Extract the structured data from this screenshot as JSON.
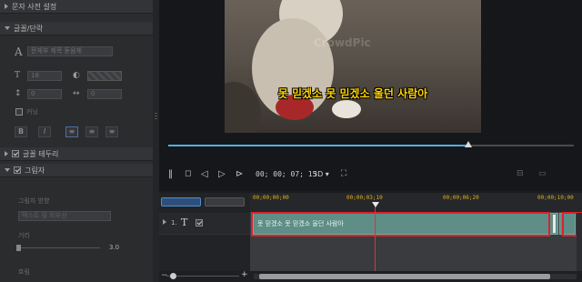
{
  "left_panel": {
    "section_char_preset": "문자 사전 설정",
    "section_font_paragraph": "글꼴/단락",
    "font_family_value": "문제부 제목 돋움체",
    "font_size_value": "18",
    "spacing_value": "0",
    "scale_value": "0",
    "extra_option_label": "커닝",
    "bold_label": "B",
    "italic_label": "I",
    "section_text_border": "글꼴 테두리",
    "section_shadow": "그림자",
    "shadow_type_label": "그림자 방향",
    "shadow_type_value": "텍스트 및 외부선",
    "distance_label": "거리",
    "distance_value": "3.0",
    "blur_label": "흐림"
  },
  "preview": {
    "subtitle_text": "못 믿겠소 못 믿겠소 울던 사람아",
    "watermark": "CrowdPic",
    "progress": 0.74,
    "timecode": "00; 00; 07; 15",
    "mode_label": "3D ▾"
  },
  "timeline": {
    "ruler_labels": [
      "00;00;00;00",
      "00;00;03;10",
      "00;00;06;20",
      "00;00;10;00"
    ],
    "track_number_label": "1.",
    "track_type_glyph": "T",
    "clip_text": "못 믿겠소 못 믿겠소 울던 사람아",
    "zoom_plus": "+",
    "zoom_minus": "−"
  },
  "colors": {
    "accent": "#4fb0e0",
    "subtitle": "#ffd400",
    "clip": "#5e8e86",
    "highlight": "#e0202c",
    "playhead": "#e0303a"
  }
}
